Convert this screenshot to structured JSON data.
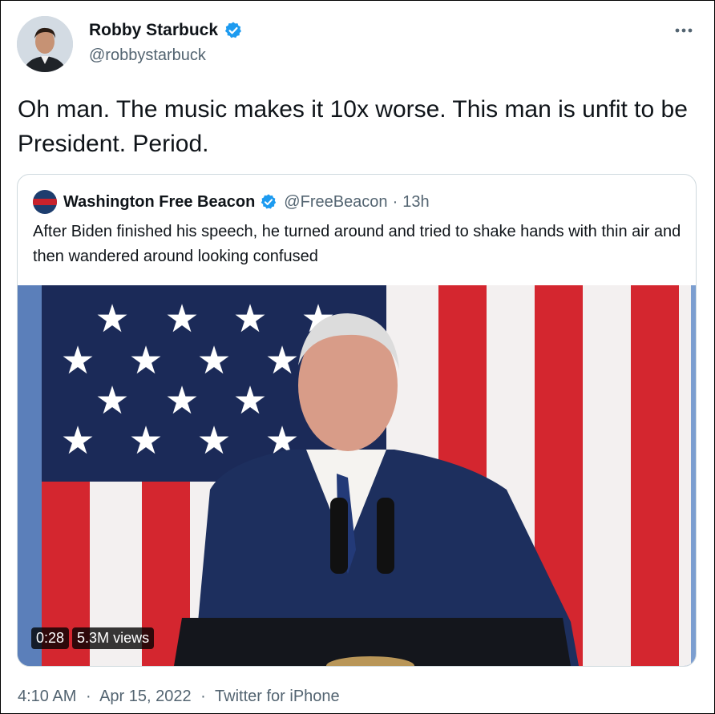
{
  "author": {
    "name": "Robby Starbuck",
    "handle": "@robbystarbuck",
    "verified": true
  },
  "tweet": {
    "text": "Oh man. The music makes it 10x worse. This man is unfit to be President. Period."
  },
  "quoted_tweet": {
    "name": "Washington Free Beacon",
    "handle": "@FreeBeacon",
    "separator": "·",
    "time": "13h",
    "verified": true,
    "text": "After Biden finished his speech, he turned around and tried to shake hands with thin air and then wandered around looking confused",
    "media": {
      "duration": "0:28",
      "views": "5.3M views"
    }
  },
  "footer": {
    "time": "4:10 AM",
    "date": "Apr 15, 2022",
    "source": "Twitter for iPhone",
    "separator": "·"
  },
  "colors": {
    "verified": "#1d9bf0",
    "secondary_text": "#536471",
    "border": "#cfd9de"
  },
  "icons": {
    "more": "more-horizontal-icon",
    "verified": "verified-badge-icon"
  }
}
